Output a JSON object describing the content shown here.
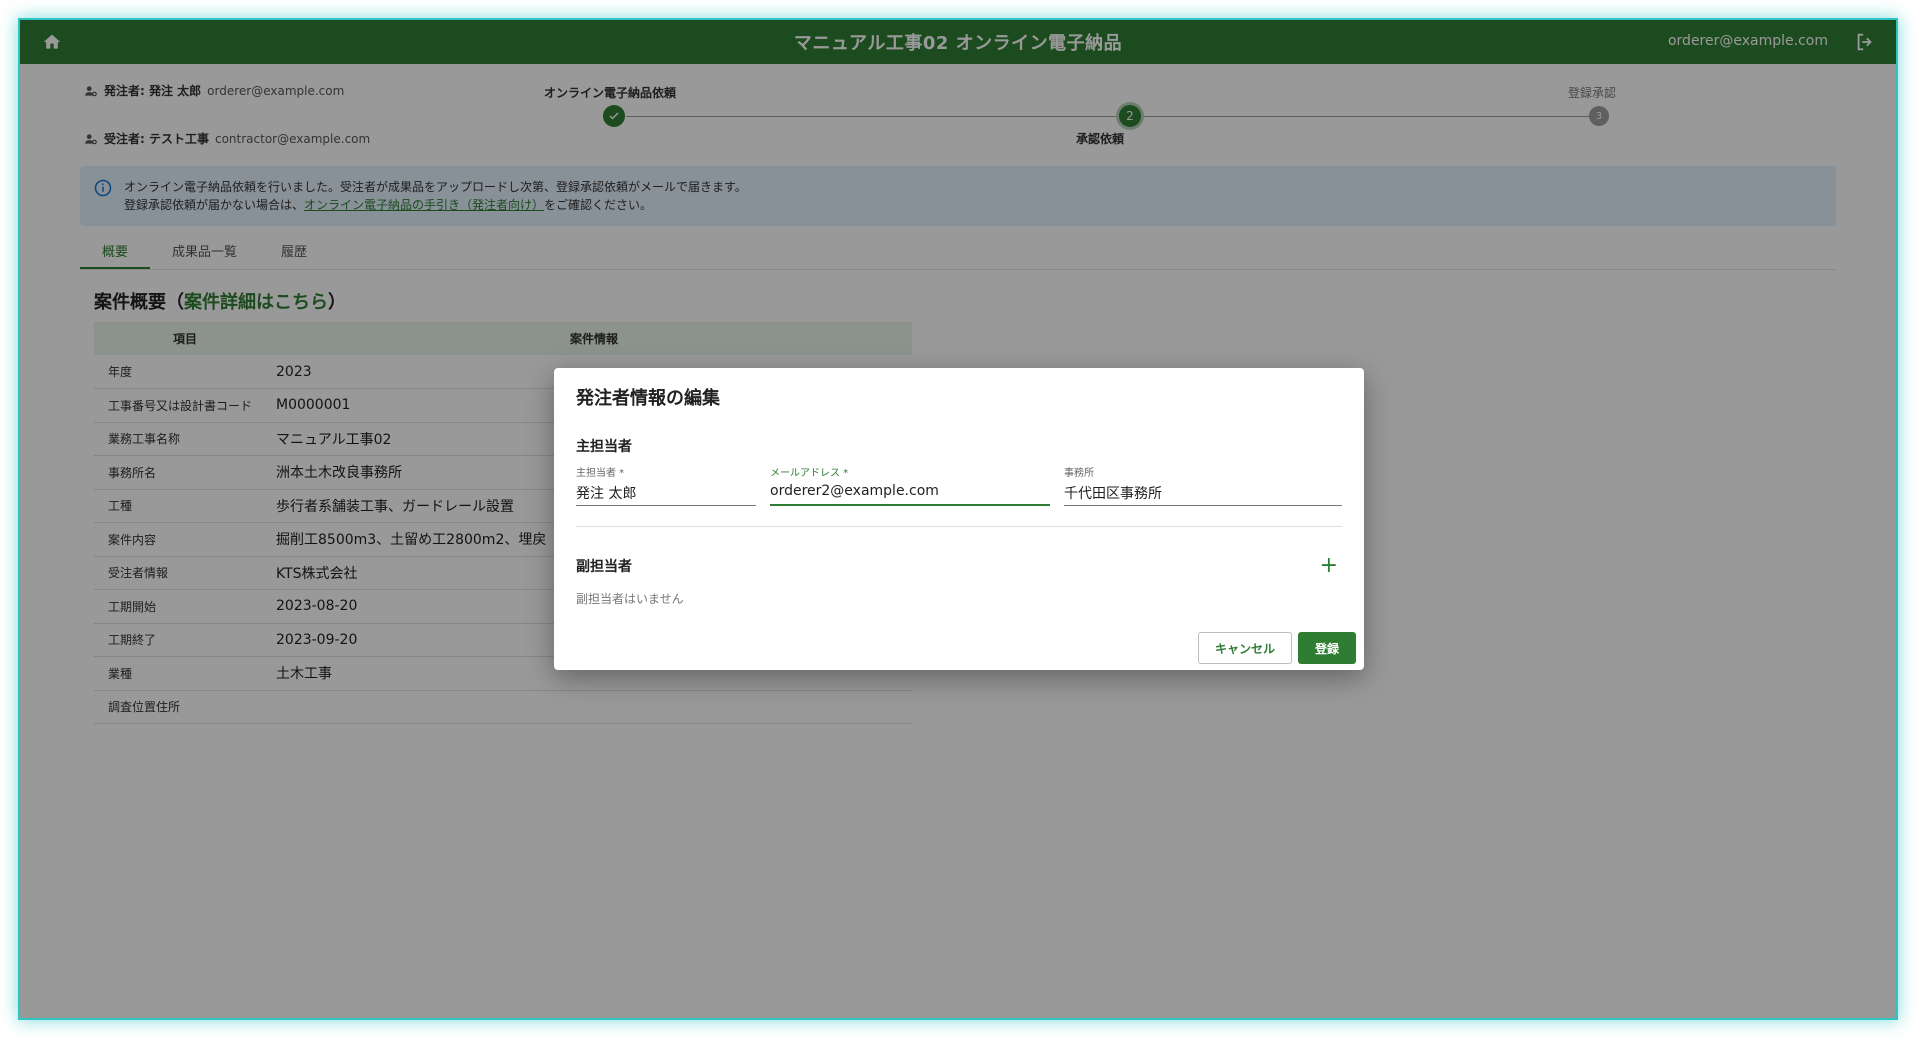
{
  "header": {
    "title": "マニュアル工事02 オンライン電子納品",
    "user_email": "orderer@example.com"
  },
  "parties": {
    "orderer_label": "発注者: 発注 太郎",
    "orderer_email": "orderer@example.com",
    "contractor_label": "受注者: テスト工事",
    "contractor_email": "contractor@example.com"
  },
  "stepper": {
    "steps": [
      {
        "label": "オンライン電子納品依頼",
        "number": "",
        "state": "done"
      },
      {
        "label": "承認依頼",
        "number": "2",
        "state": "active"
      },
      {
        "label": "登録承認",
        "number": "3",
        "state": "pending"
      }
    ]
  },
  "info": {
    "line1": "オンライン電子納品依頼を行いました。受注者が成果品をアップロードし次第、登録承認依頼がメールで届きます。",
    "line2_prefix": "登録承認依頼が届かない場合は、",
    "line2_link": "オンライン電子納品の手引き（発注者向け）",
    "line2_suffix": "をご確認ください。"
  },
  "tabs": [
    "概要",
    "成果品一覧",
    "履歴"
  ],
  "summary": {
    "title_prefix": "案件概要（",
    "title_link": "案件詳細はこちら",
    "title_suffix": "）",
    "col_item": "項目",
    "col_info": "案件情報",
    "rows": [
      {
        "k": "年度",
        "v": "2023"
      },
      {
        "k": "工事番号又は設計書コード",
        "v": "M0000001"
      },
      {
        "k": "業務工事名称",
        "v": "マニュアル工事02"
      },
      {
        "k": "事務所名",
        "v": "洲本土木改良事務所"
      },
      {
        "k": "工種",
        "v": "歩行者系舗装工事、ガードレール設置"
      },
      {
        "k": "案件内容",
        "v": "掘削工8500m3、土留め工2800m2、埋戻"
      },
      {
        "k": "受注者情報",
        "v": "KTS株式会社"
      },
      {
        "k": "工期開始",
        "v": "2023-08-20"
      },
      {
        "k": "工期終了",
        "v": "2023-09-20"
      },
      {
        "k": "業種",
        "v": "土木工事"
      },
      {
        "k": "調査位置住所",
        "v": ""
      }
    ]
  },
  "dialog": {
    "title": "発注者情報の編集",
    "main_section": "主担当者",
    "name_label": "主担当者 *",
    "name_value": "発注 太郎",
    "email_label": "メールアドレス *",
    "email_value": "orderer2@example.com",
    "office_label": "事務所",
    "office_value": "千代田区事務所",
    "sub_section": "副担当者",
    "no_sub": "副担当者はいません",
    "cancel": "キャンセル",
    "submit": "登録"
  },
  "colors": {
    "primary": "#2e7d32",
    "info_bg": "#e3f2fd"
  }
}
